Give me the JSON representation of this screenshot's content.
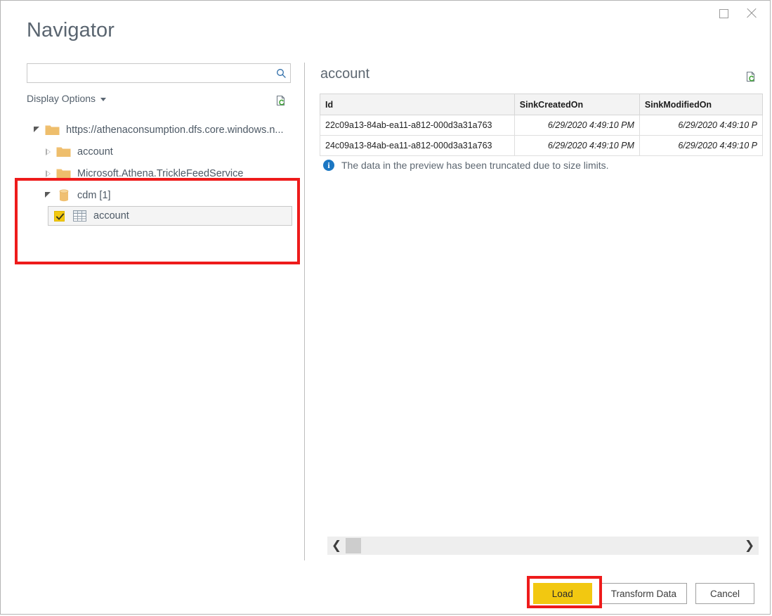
{
  "window": {
    "title": "Navigator",
    "restore_label": "Restore",
    "close_label": "Close"
  },
  "left_panel": {
    "search": {
      "value": "",
      "placeholder": "",
      "icon": "search-icon"
    },
    "display_options_label": "Display Options",
    "refresh_icon": "refresh-page-icon",
    "tree": [
      {
        "label": "https://athenaconsumption.dfs.core.windows.n...",
        "icon": "folder-icon",
        "level": 1,
        "expanded": true
      },
      {
        "label": "account",
        "icon": "folder-icon",
        "level": 2,
        "expanded": false
      },
      {
        "label": "Microsoft.Athena.TrickleFeedService",
        "icon": "folder-icon",
        "level": 2,
        "expanded": false
      },
      {
        "label": "cdm [1]",
        "icon": "database-icon",
        "level": 2,
        "expanded": true
      }
    ],
    "selected_item": {
      "label": "account",
      "icon": "table-icon",
      "checked": true
    }
  },
  "right_panel": {
    "preview_title": "account",
    "refresh_icon": "refresh-page-icon",
    "columns": [
      "Id",
      "SinkCreatedOn",
      "SinkModifiedOn"
    ],
    "rows": [
      [
        "22c09a13-84ab-ea11-a812-000d3a31a763",
        "6/29/2020 4:49:10 PM",
        "6/29/2020 4:49:10 P"
      ],
      [
        "24c09a13-84ab-ea11-a812-000d3a31a763",
        "6/29/2020 4:49:10 PM",
        "6/29/2020 4:49:10 P"
      ]
    ],
    "info_message": "The data in the preview has been truncated due to size limits.",
    "info_icon": "info-icon",
    "scroll": {
      "left_arrow": "❮",
      "right_arrow": "❯",
      "thumb_position_percent": 0
    }
  },
  "footer": {
    "load_label": "Load",
    "transform_label": "Transform Data",
    "cancel_label": "Cancel"
  },
  "colors": {
    "accent": "#f2c811",
    "highlight": "#ee1b1b",
    "folder": "#f0c072",
    "info": "#1c77c3",
    "title_text": "#5a6570"
  },
  "annotations": [
    {
      "name": "tree-selection-highlight"
    },
    {
      "name": "load-button-highlight"
    }
  ]
}
